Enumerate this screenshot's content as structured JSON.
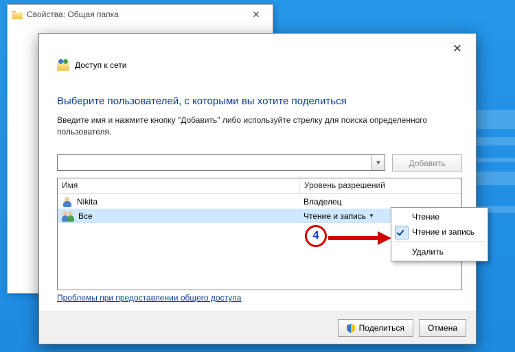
{
  "back_window": {
    "title": "Свойства: Общая папка"
  },
  "dialog": {
    "title": "Доступ к сети",
    "heading": "Выберите пользователей, с которыми вы хотите поделиться",
    "description": "Введите имя и нажмите кнопку \"Добавить\" либо используйте стрелку для поиска определенного пользователя.",
    "input_value": "",
    "add_button": "Добавить",
    "columns": {
      "name": "Имя",
      "permission": "Уровень разрешений"
    },
    "rows": [
      {
        "name": "Nikita",
        "permission": "Владелец",
        "type": "user",
        "selected": false,
        "dropdown": false
      },
      {
        "name": "Все",
        "permission": "Чтение и запись",
        "type": "group",
        "selected": true,
        "dropdown": true
      }
    ],
    "troubleshoot_link": "Проблемы при предоставлении общего доступа",
    "share_button": "Поделиться",
    "cancel_button": "Отмена"
  },
  "context_menu": {
    "items": [
      {
        "label": "Чтение",
        "checked": false
      },
      {
        "label": "Чтение и запись",
        "checked": true
      }
    ],
    "delete_label": "Удалить"
  },
  "annotation": {
    "number": "4"
  }
}
